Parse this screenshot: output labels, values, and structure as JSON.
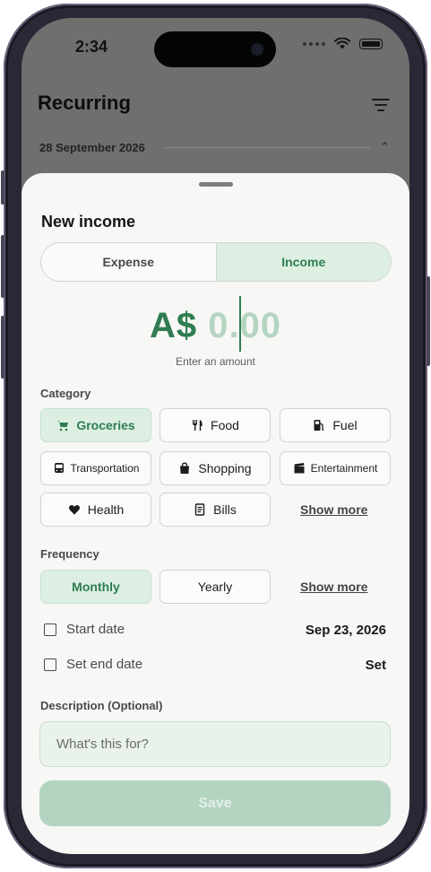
{
  "status_bar": {
    "time": "2:34"
  },
  "background": {
    "title": "Recurring",
    "date_header": "28 September 2026"
  },
  "sheet": {
    "title": "New income",
    "segments": [
      "Expense",
      "Income"
    ],
    "selected_segment": "Income",
    "amount": {
      "currency": "A$",
      "value": "0.00",
      "hint": "Enter an amount"
    },
    "category": {
      "label": "Category",
      "items": [
        {
          "label": "Groceries",
          "icon": "cart-icon",
          "selected": true
        },
        {
          "label": "Food",
          "icon": "cutlery-icon",
          "selected": false
        },
        {
          "label": "Fuel",
          "icon": "fuel-pump-icon",
          "selected": false
        },
        {
          "label": "Transportation",
          "icon": "bus-icon",
          "selected": false
        },
        {
          "label": "Shopping",
          "icon": "shopping-bag-icon",
          "selected": false
        },
        {
          "label": "Entertainment",
          "icon": "clapperboard-icon",
          "selected": false
        },
        {
          "label": "Health",
          "icon": "heart-icon",
          "selected": false
        },
        {
          "label": "Bills",
          "icon": "receipt-icon",
          "selected": false
        }
      ],
      "show_more": "Show more"
    },
    "frequency": {
      "label": "Frequency",
      "items": [
        {
          "label": "Monthly",
          "selected": true
        },
        {
          "label": "Yearly",
          "selected": false
        }
      ],
      "show_more": "Show more"
    },
    "start_date": {
      "label": "Start date",
      "value": "Sep 23, 2026"
    },
    "end_date": {
      "label": "Set end date",
      "value": "Set"
    },
    "description": {
      "label": "Description (Optional)",
      "placeholder": "What's this for?"
    },
    "save_label": "Save"
  },
  "colors": {
    "accent": "#2f7d51",
    "accent_light": "#dcefe2",
    "save_disabled": "#b3d4c1",
    "sheet_bg": "#f7f7f5"
  }
}
